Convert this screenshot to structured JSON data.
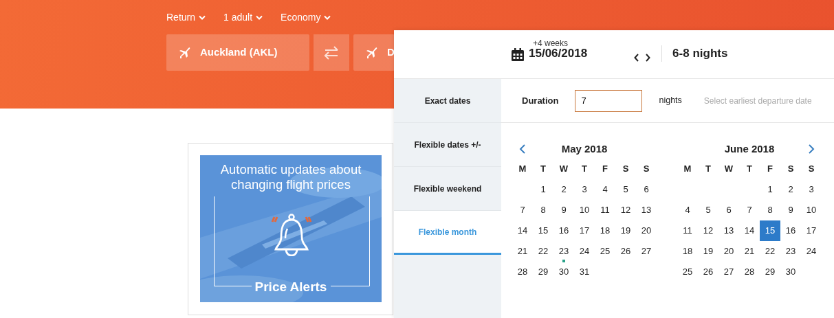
{
  "trip_options": [
    {
      "label": "Return"
    },
    {
      "label": "1 adult"
    },
    {
      "label": "Economy"
    }
  ],
  "origin": {
    "value": "Auckland (AKL)"
  },
  "destination": {
    "value": "D"
  },
  "banner": {
    "headline": "Automatic updates about changing flight prices",
    "title": "Price Alerts"
  },
  "picker": {
    "offset": "+4 weeks",
    "date": "15/06/2018",
    "nights": "6-8 nights",
    "tabs": [
      {
        "label": "Exact dates",
        "selected": false
      },
      {
        "label": "Flexible dates +/-",
        "selected": false
      },
      {
        "label": "Flexible weekend",
        "selected": false
      },
      {
        "label": "Flexible month",
        "selected": true
      }
    ],
    "duration": {
      "label": "Duration",
      "value": "7",
      "unit": "nights",
      "hint": "Select earliest departure date"
    },
    "months": [
      {
        "title": "May 2018",
        "weekdays": [
          "M",
          "T",
          "W",
          "T",
          "F",
          "S",
          "S"
        ],
        "weeks": [
          {
            "kind": "first",
            "days": [
              {
                "d": "1",
                "selected": false,
                "marked": false
              },
              {
                "d": "2",
                "selected": false,
                "marked": false
              },
              {
                "d": "3",
                "selected": false,
                "marked": false
              },
              {
                "d": "4",
                "selected": false,
                "marked": false
              },
              {
                "d": "5",
                "selected": false,
                "marked": false
              },
              {
                "d": "6",
                "selected": false,
                "marked": false
              }
            ]
          },
          {
            "days": [
              {
                "d": "7",
                "selected": false,
                "marked": false
              },
              {
                "d": "8",
                "selected": false,
                "marked": false
              },
              {
                "d": "9",
                "selected": false,
                "marked": false
              },
              {
                "d": "10",
                "selected": false,
                "marked": false
              },
              {
                "d": "11",
                "selected": false,
                "marked": false
              },
              {
                "d": "12",
                "selected": false,
                "marked": false
              },
              {
                "d": "13",
                "selected": false,
                "marked": false
              }
            ]
          },
          {
            "days": [
              {
                "d": "14",
                "selected": false,
                "marked": false
              },
              {
                "d": "15",
                "selected": false,
                "marked": false
              },
              {
                "d": "16",
                "selected": false,
                "marked": false
              },
              {
                "d": "17",
                "selected": false,
                "marked": false
              },
              {
                "d": "18",
                "selected": false,
                "marked": false
              },
              {
                "d": "19",
                "selected": false,
                "marked": false
              },
              {
                "d": "20",
                "selected": false,
                "marked": false
              }
            ]
          },
          {
            "days": [
              {
                "d": "21",
                "selected": false,
                "marked": false
              },
              {
                "d": "22",
                "selected": false,
                "marked": false
              },
              {
                "d": "23",
                "selected": false,
                "marked": true
              },
              {
                "d": "24",
                "selected": false,
                "marked": false
              },
              {
                "d": "25",
                "selected": false,
                "marked": false
              },
              {
                "d": "26",
                "selected": false,
                "marked": false
              },
              {
                "d": "27",
                "selected": false,
                "marked": false
              }
            ]
          },
          {
            "kind": "last",
            "days": [
              {
                "d": "28",
                "selected": false,
                "marked": false
              },
              {
                "d": "29",
                "selected": false,
                "marked": false
              },
              {
                "d": "30",
                "selected": false,
                "marked": false
              },
              {
                "d": "31",
                "selected": false,
                "marked": false
              }
            ]
          }
        ]
      },
      {
        "title": "June 2018",
        "weekdays": [
          "M",
          "T",
          "W",
          "T",
          "F",
          "S",
          "S"
        ],
        "weeks": [
          {
            "kind": "first",
            "days": [
              {
                "d": "1",
                "selected": false,
                "marked": false
              },
              {
                "d": "2",
                "selected": false,
                "marked": false
              },
              {
                "d": "3",
                "selected": false,
                "marked": false
              }
            ]
          },
          {
            "days": [
              {
                "d": "4",
                "selected": false,
                "marked": false
              },
              {
                "d": "5",
                "selected": false,
                "marked": false
              },
              {
                "d": "6",
                "selected": false,
                "marked": false
              },
              {
                "d": "7",
                "selected": false,
                "marked": false
              },
              {
                "d": "8",
                "selected": false,
                "marked": false
              },
              {
                "d": "9",
                "selected": false,
                "marked": false
              },
              {
                "d": "10",
                "selected": false,
                "marked": false
              }
            ]
          },
          {
            "days": [
              {
                "d": "11",
                "selected": false,
                "marked": false
              },
              {
                "d": "12",
                "selected": false,
                "marked": false
              },
              {
                "d": "13",
                "selected": false,
                "marked": false
              },
              {
                "d": "14",
                "selected": false,
                "marked": false
              },
              {
                "d": "15",
                "selected": true,
                "marked": false
              },
              {
                "d": "16",
                "selected": false,
                "marked": false
              },
              {
                "d": "17",
                "selected": false,
                "marked": false
              }
            ]
          },
          {
            "days": [
              {
                "d": "18",
                "selected": false,
                "marked": false
              },
              {
                "d": "19",
                "selected": false,
                "marked": false
              },
              {
                "d": "20",
                "selected": false,
                "marked": false
              },
              {
                "d": "21",
                "selected": false,
                "marked": false
              },
              {
                "d": "22",
                "selected": false,
                "marked": false
              },
              {
                "d": "23",
                "selected": false,
                "marked": false
              },
              {
                "d": "24",
                "selected": false,
                "marked": false
              }
            ]
          },
          {
            "kind": "last",
            "days": [
              {
                "d": "25",
                "selected": false,
                "marked": false
              },
              {
                "d": "26",
                "selected": false,
                "marked": false
              },
              {
                "d": "27",
                "selected": false,
                "marked": false
              },
              {
                "d": "28",
                "selected": false,
                "marked": false
              },
              {
                "d": "29",
                "selected": false,
                "marked": false
              },
              {
                "d": "30",
                "selected": false,
                "marked": false
              }
            ]
          }
        ]
      }
    ]
  }
}
